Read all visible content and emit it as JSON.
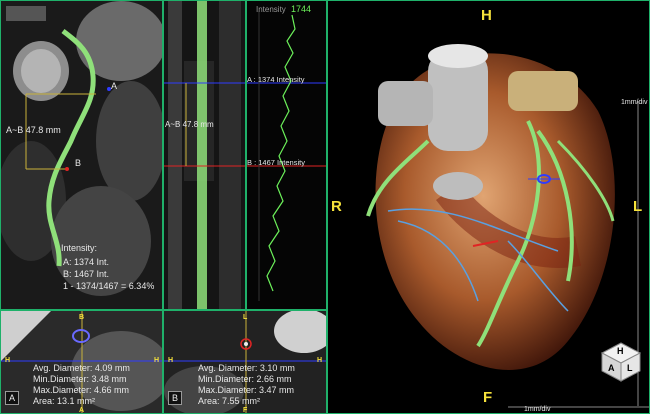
{
  "curved_mpr": {
    "marker_a": "A",
    "marker_b": "B",
    "distance_label": "A~B 47.8 mm",
    "intensity_title": "Intensity:",
    "intensity_a": "A: 1374 Int.",
    "intensity_b": "B: 1467 Int.",
    "intensity_ratio": "1 - 1374/1467 = 6.34%"
  },
  "straight_mpr": {
    "distance_label": "A~B 47.8 mm"
  },
  "intensity_profile": {
    "title": "Intensity",
    "max_value": "1744",
    "marker_a_label": "A : 1374 Intensity",
    "marker_b_label": "B : 1467 Intensity"
  },
  "cross_section_a": {
    "label": "A",
    "avg_diameter": "Avg. Diameter: 4.09 mm",
    "min_diameter": "Min.Diameter: 3.48 mm",
    "max_diameter": "Max.Diameter: 4.66 mm",
    "area": "Area: 13.1 mm²",
    "orientation_left": "H",
    "orientation_right": "H",
    "orientation_top": "B",
    "orientation_bottom": "A"
  },
  "cross_section_b": {
    "label": "B",
    "avg_diameter": "Avg. Diameter: 3.10 mm",
    "min_diameter": "Min.Diameter: 2.66 mm",
    "max_diameter": "Max.Diameter: 3.47 mm",
    "area": "Area: 7.55 mm²",
    "orientation_left": "H",
    "orientation_right": "H",
    "orientation_top": "L",
    "orientation_bottom": "F"
  },
  "volume_render": {
    "orient_top": "H",
    "orient_left": "R",
    "orient_right": "L",
    "orient_bottom": "F",
    "scale_right": "1mm/div",
    "scale_bottom": "1mm/div",
    "cube_faces": [
      "H",
      "A",
      "L"
    ]
  },
  "colors": {
    "frame": "#1fb16a",
    "vessel": "#8fe07a",
    "marker_a_line": "#2f3cff",
    "marker_b_line": "#e02424",
    "label_yellow": "#f6e23b"
  }
}
